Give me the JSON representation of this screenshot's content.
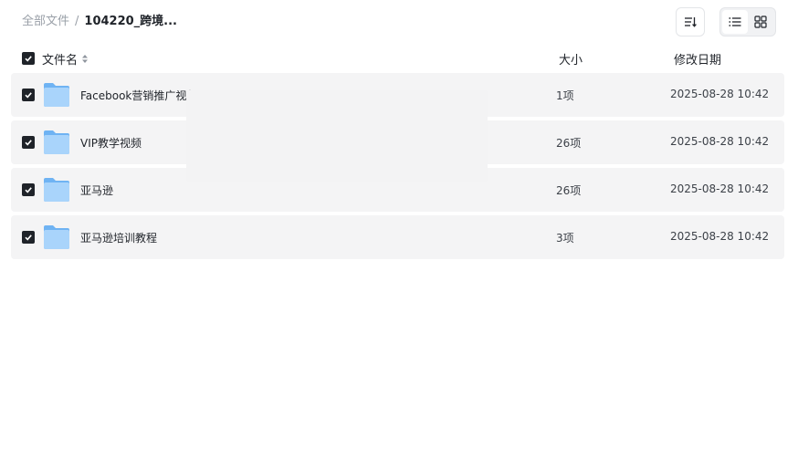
{
  "breadcrumb": {
    "root": "全部文件",
    "separator": "/",
    "current": "104220_跨境..."
  },
  "toolbar": {
    "sort_icon": "sort-lines-arrow-icon",
    "list_view_icon": "list-view-icon",
    "grid_view_icon": "grid-view-icon",
    "active_view": "list"
  },
  "columns": {
    "name": "文件名",
    "size": "大小",
    "date": "修改日期",
    "sort_icon": "sort-up-down-icon"
  },
  "files": [
    {
      "name": "Facebook营销推广视频",
      "size": "1项",
      "modified": "2025-08-28 10:42",
      "selected": true
    },
    {
      "name": "VIP教学视频",
      "size": "26项",
      "modified": "2025-08-28 10:42",
      "selected": true
    },
    {
      "name": "亚马逊",
      "size": "26项",
      "modified": "2025-08-28 10:42",
      "selected": true
    },
    {
      "name": "亚马逊培训教程",
      "size": "3项",
      "modified": "2025-08-28 10:42",
      "selected": true
    }
  ],
  "colors": {
    "checkbox": "#1f2329",
    "row_background": "#f4f4f5",
    "folder_light": "#a9d4fb",
    "folder_dark": "#6fb3f3"
  }
}
